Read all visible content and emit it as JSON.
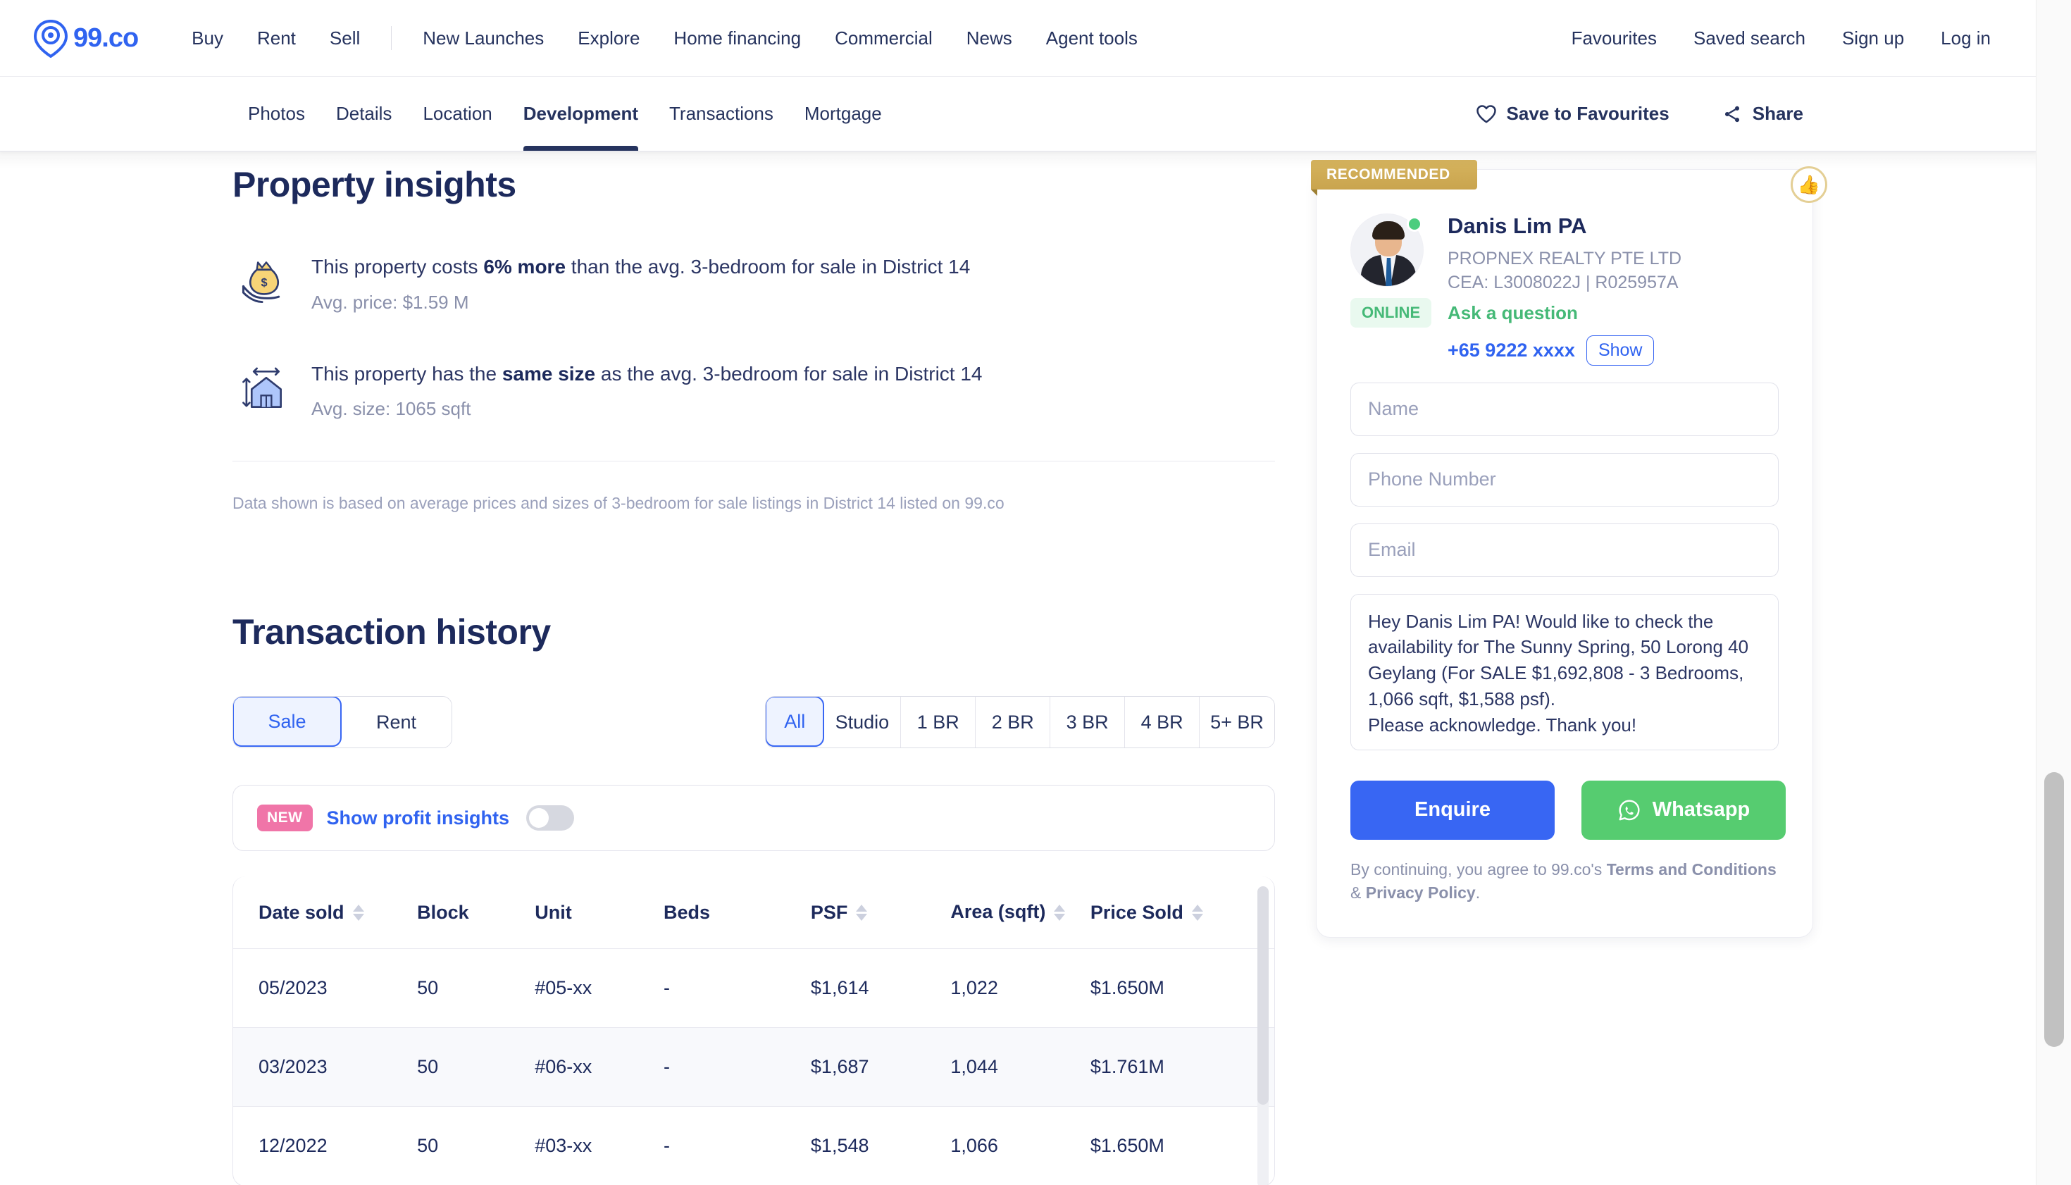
{
  "brand": {
    "logo_text": "99.co",
    "accent": "#3063f0",
    "navy": "#1d2a5c"
  },
  "topnav": {
    "primary": [
      "Buy",
      "Rent",
      "Sell"
    ],
    "secondary": [
      "New Launches",
      "Explore",
      "Home financing",
      "Commercial",
      "News",
      "Agent tools"
    ],
    "right": [
      "Favourites",
      "Saved search",
      "Sign up",
      "Log in"
    ]
  },
  "subnav": {
    "tabs": [
      {
        "label": "Photos",
        "active": false
      },
      {
        "label": "Details",
        "active": false
      },
      {
        "label": "Location",
        "active": false
      },
      {
        "label": "Development",
        "active": true
      },
      {
        "label": "Transactions",
        "active": false
      },
      {
        "label": "Mortgage",
        "active": false
      }
    ],
    "save_label": "Save to Favourites",
    "share_label": "Share"
  },
  "insights": {
    "title": "Property insights",
    "items": [
      {
        "icon": "money-bag-icon",
        "text_before": "This property costs ",
        "highlight": "6% more",
        "text_after": " than the avg. 3-bedroom for sale in District 14",
        "sub": "Avg. price: $1.59 M"
      },
      {
        "icon": "house-size-icon",
        "text_before": "This property has the ",
        "highlight": "same size",
        "text_after": " as the avg. 3-bedroom for sale in District 14",
        "sub": "Avg. size: 1065 sqft"
      }
    ],
    "disclaimer": "Data shown is based on average prices and sizes of 3-bedroom for sale listings in District 14 listed on 99.co"
  },
  "transactions": {
    "title": "Transaction history",
    "type_filter": {
      "options": [
        "Sale",
        "Rent"
      ],
      "selected": "Sale"
    },
    "bedroom_filter": {
      "options": [
        "All",
        "Studio",
        "1 BR",
        "2 BR",
        "3 BR",
        "4 BR",
        "5+ BR"
      ],
      "selected": "All"
    },
    "profit_insights": {
      "badge": "NEW",
      "label": "Show profit insights",
      "enabled": false
    },
    "columns": [
      {
        "label": "Date sold",
        "sortable": true
      },
      {
        "label": "Block",
        "sortable": false
      },
      {
        "label": "Unit",
        "sortable": false
      },
      {
        "label": "Beds",
        "sortable": false
      },
      {
        "label": "PSF",
        "sortable": true
      },
      {
        "label": "Area (sqft)",
        "sortable": true
      },
      {
        "label": "Price Sold",
        "sortable": true
      }
    ],
    "rows": [
      {
        "date": "05/2023",
        "block": "50",
        "unit": "#05-xx",
        "beds": "-",
        "psf": "$1,614",
        "area": "1,022",
        "price": "$1.650M"
      },
      {
        "date": "03/2023",
        "block": "50",
        "unit": "#06-xx",
        "beds": "-",
        "psf": "$1,687",
        "area": "1,044",
        "price": "$1.761M"
      },
      {
        "date": "12/2022",
        "block": "50",
        "unit": "#03-xx",
        "beds": "-",
        "psf": "$1,548",
        "area": "1,066",
        "price": "$1.650M"
      }
    ]
  },
  "agent_card": {
    "recommended_badge": "RECOMMENDED",
    "name": "Danis Lim PA",
    "agency": "PROPNEX REALTY PTE LTD",
    "cea": "CEA: L3008022J | R025957A",
    "ask_question": "Ask a question",
    "status": "ONLINE",
    "phone": "+65 9222 xxxx",
    "show_button": "Show",
    "fields": {
      "name_placeholder": "Name",
      "phone_placeholder": "Phone Number",
      "email_placeholder": "Email",
      "message_value": "Hey Danis Lim PA! Would like to check the availability for The Sunny Spring, 50 Lorong 40 Geylang (For SALE $1,692,808 - 3 Bedrooms, 1,066 sqft, $1,588 psf).\nPlease acknowledge. Thank you!"
    },
    "enquire_label": "Enquire",
    "whatsapp_label": "Whatsapp",
    "terms_prefix": "By continuing, you agree to 99.co's ",
    "terms_link1": "Terms and Conditions",
    "terms_mid": " & ",
    "terms_link2": "Privacy Policy",
    "terms_suffix": "."
  }
}
